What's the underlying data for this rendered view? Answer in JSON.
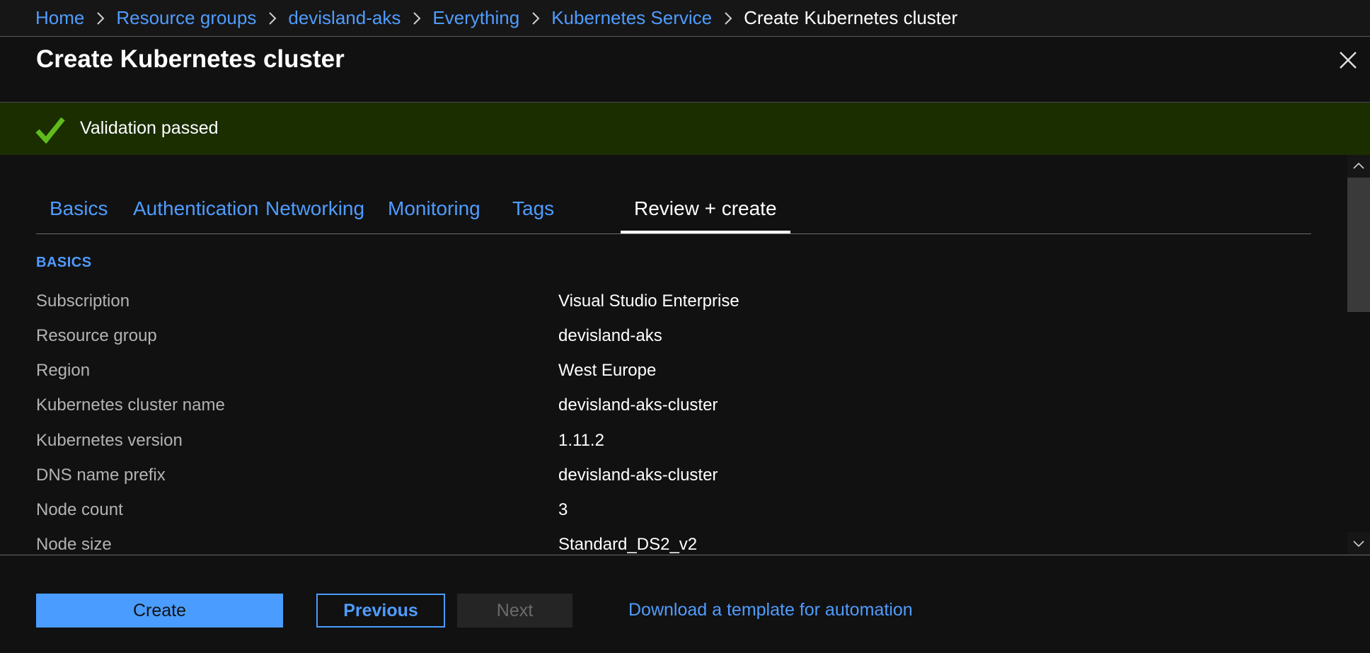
{
  "breadcrumb": {
    "items": [
      {
        "label": "Home"
      },
      {
        "label": "Resource groups"
      },
      {
        "label": "devisland-aks"
      },
      {
        "label": "Everything"
      },
      {
        "label": "Kubernetes Service"
      },
      {
        "label": "Create Kubernetes cluster"
      }
    ]
  },
  "header": {
    "title": "Create Kubernetes cluster"
  },
  "banner": {
    "status_text": "Validation passed",
    "color": "#1b2e00",
    "icon": "checkmark-icon"
  },
  "tabs": [
    {
      "label": "Basics",
      "active": false
    },
    {
      "label": "Authentication",
      "active": false
    },
    {
      "label": "Networking",
      "active": false
    },
    {
      "label": "Monitoring",
      "active": false
    },
    {
      "label": "Tags",
      "active": false
    },
    {
      "label": "Review + create",
      "active": true
    }
  ],
  "review": {
    "section_title": "BASICS",
    "rows": [
      {
        "label": "Subscription",
        "value": "Visual Studio Enterprise"
      },
      {
        "label": "Resource group",
        "value": "devisland-aks"
      },
      {
        "label": "Region",
        "value": "West Europe"
      },
      {
        "label": "Kubernetes cluster name",
        "value": "devisland-aks-cluster"
      },
      {
        "label": "Kubernetes version",
        "value": "1.11.2"
      },
      {
        "label": "DNS name prefix",
        "value": "devisland-aks-cluster"
      },
      {
        "label": "Node count",
        "value": "3"
      },
      {
        "label": "Node size",
        "value": "Standard_DS2_v2"
      }
    ]
  },
  "scrollbar": {
    "position_fraction": 0.0,
    "visible_fraction": 0.38
  },
  "footer": {
    "create_label": "Create",
    "previous_label": "Previous",
    "next_label": "Next",
    "download_link": "Download a template for automation"
  },
  "colors": {
    "accent": "#4a9dff",
    "link": "#4f9cff",
    "success_banner": "#1b2e00",
    "success_check": "#5fbb1d",
    "background": "#111111"
  }
}
